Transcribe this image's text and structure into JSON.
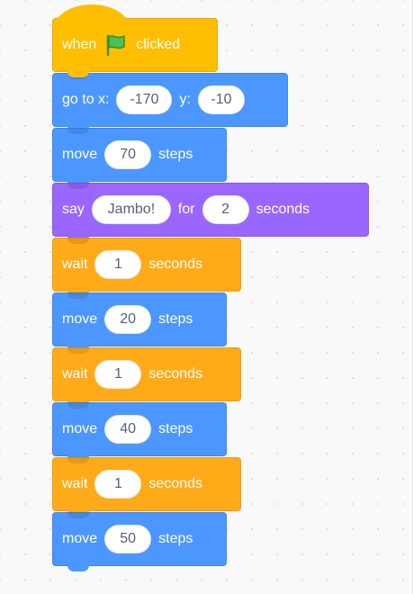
{
  "script": {
    "hat": {
      "label_before": "when",
      "icon": "green-flag-icon",
      "label_after": "clicked",
      "color": "#ffbf00"
    },
    "blocks": [
      {
        "category": "motion",
        "color": "#4c97ff",
        "parts": [
          "go to x:",
          "-170",
          "y:",
          "-10"
        ]
      },
      {
        "category": "motion",
        "color": "#4c97ff",
        "parts": [
          "move",
          "70",
          "steps"
        ]
      },
      {
        "category": "looks",
        "color": "#9966ff",
        "parts": [
          "say",
          "Jambo!",
          "for",
          "2",
          "seconds"
        ]
      },
      {
        "category": "control",
        "color": "#ffab19",
        "parts": [
          "wait",
          "1",
          "seconds"
        ]
      },
      {
        "category": "motion",
        "color": "#4c97ff",
        "parts": [
          "move",
          "20",
          "steps"
        ]
      },
      {
        "category": "control",
        "color": "#ffab19",
        "parts": [
          "wait",
          "1",
          "seconds"
        ]
      },
      {
        "category": "motion",
        "color": "#4c97ff",
        "parts": [
          "move",
          "40",
          "steps"
        ]
      },
      {
        "category": "control",
        "color": "#ffab19",
        "parts": [
          "wait",
          "1",
          "seconds"
        ]
      },
      {
        "category": "motion",
        "color": "#4c97ff",
        "parts": [
          "move",
          "50",
          "steps"
        ]
      }
    ]
  }
}
